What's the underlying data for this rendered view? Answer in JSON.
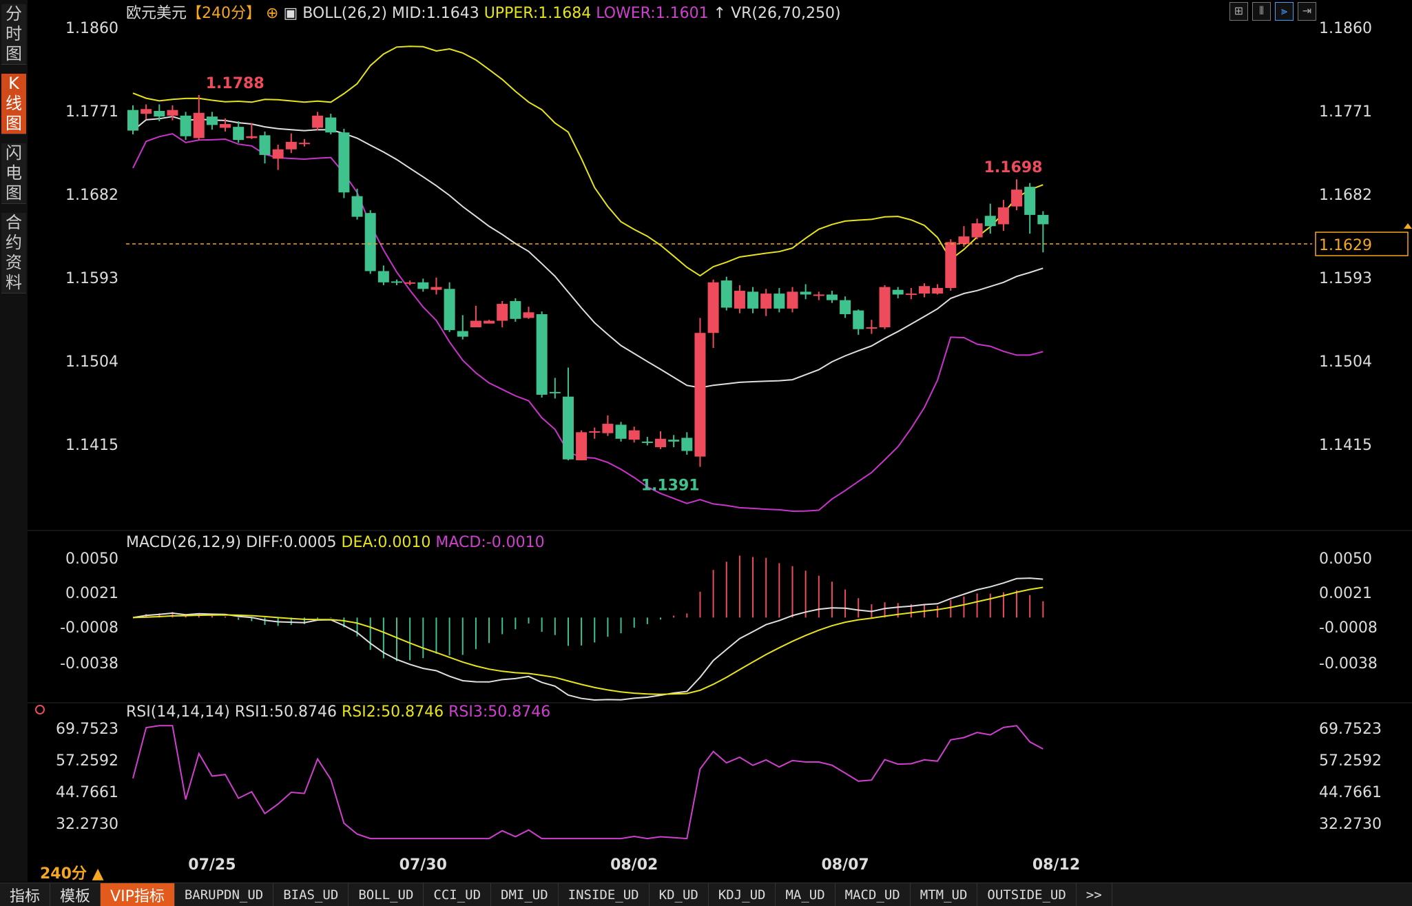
{
  "sidebar": {
    "tabs": [
      {
        "label": "分时图",
        "active": false
      },
      {
        "label": "K线图",
        "active": true
      },
      {
        "label": "闪电图",
        "active": false
      },
      {
        "label": "合约资料",
        "active": false
      }
    ]
  },
  "header": {
    "symbol": "欧元美元",
    "period": "【240分】",
    "indicator": "BOLL(26,2)",
    "mid": "MID:1.1643",
    "upper": "UPPER:1.1684",
    "lower": "LOWER:1.1601",
    "vr": "VR(26,70,250)"
  },
  "toolbar_icons": [
    "grid-icon",
    "bar-icon",
    "line-icon",
    "arrow-right-icon"
  ],
  "price_axis": {
    "ticks": [
      1.186,
      1.1771,
      1.1682,
      1.1593,
      1.1504,
      1.1415
    ],
    "tick_labels": [
      "1.1860",
      "1.1771",
      "1.1682",
      "1.1593",
      "1.1504",
      "1.1415"
    ],
    "current_price": "1.1629",
    "current_value": 1.1629
  },
  "annotations": {
    "high": {
      "label": "1.1788",
      "value": 1.1788,
      "index": 5
    },
    "low": {
      "label": "1.1391",
      "value": 1.1391,
      "index": 38
    },
    "swing": {
      "label": "1.1698",
      "value": 1.1698,
      "index": 64
    }
  },
  "macd": {
    "header": "MACD(26,12,9)",
    "diff": "DIFF:0.0005",
    "dea": "DEA:0.0010",
    "macd": "MACD:-0.0010",
    "ticks": [
      0.005,
      0.0021,
      -0.0008,
      -0.0038
    ],
    "tick_labels": [
      "0.0050",
      "0.0021",
      "-0.0008",
      "-0.0038"
    ]
  },
  "rsi": {
    "header": "RSI(14,14,14)",
    "rsi1": "RSI1:50.8746",
    "rsi2": "RSI2:50.8746",
    "rsi3": "RSI3:50.8746",
    "ticks": [
      69.7523,
      57.2592,
      44.7661,
      32.273
    ],
    "tick_labels": [
      "69.7523",
      "57.2592",
      "44.7661",
      "32.2730"
    ]
  },
  "x_axis": {
    "labels": [
      {
        "label": "07/25",
        "index": 6
      },
      {
        "label": "07/30",
        "index": 22
      },
      {
        "label": "08/02",
        "index": 38
      },
      {
        "label": "08/07",
        "index": 54
      },
      {
        "label": "08/12",
        "index": 70
      }
    ]
  },
  "period_label": "240分 ▲",
  "bottom_tabs": [
    {
      "label": "指标",
      "big": true
    },
    {
      "label": "模板",
      "big": true
    },
    {
      "label": "VIP指标",
      "big": true,
      "active": true
    },
    {
      "label": "BARUPDN_UD"
    },
    {
      "label": "BIAS_UD"
    },
    {
      "label": "BOLL_UD"
    },
    {
      "label": "CCI_UD"
    },
    {
      "label": "DMI_UD"
    },
    {
      "label": "INSIDE_UD"
    },
    {
      "label": "KD_UD"
    },
    {
      "label": "KDJ_UD"
    },
    {
      "label": "MA_UD"
    },
    {
      "label": "MACD_UD"
    },
    {
      "label": "MTM_UD"
    },
    {
      "label": "OUTSIDE_UD"
    },
    {
      "label": ">>"
    }
  ],
  "colors": {
    "up": "#ee4b5c",
    "down": "#3fc28e",
    "boll_mid": "#e0e0e0",
    "boll_upper": "#e8e41c",
    "boll_lower": "#cc33cc",
    "orange": "#f5a623"
  },
  "chart_data": {
    "type": "candlestick",
    "candles": [
      [
        1.1772,
        1.175,
        1.1777,
        1.1746
      ],
      [
        1.1768,
        1.1773,
        1.1778,
        1.1762
      ],
      [
        1.1771,
        1.1765,
        1.1778,
        1.176
      ],
      [
        1.1766,
        1.1772,
        1.1777,
        1.1761
      ],
      [
        1.1766,
        1.1744,
        1.177,
        1.174
      ],
      [
        1.1742,
        1.1769,
        1.1788,
        1.174
      ],
      [
        1.1765,
        1.1756,
        1.177,
        1.1751
      ],
      [
        1.1753,
        1.1757,
        1.1763,
        1.1749
      ],
      [
        1.1754,
        1.174,
        1.176,
        1.1737
      ],
      [
        1.1742,
        1.1744,
        1.1758,
        1.1741
      ],
      [
        1.1745,
        1.1724,
        1.1749,
        1.1715
      ],
      [
        1.172,
        1.173,
        1.1735,
        1.1708
      ],
      [
        1.173,
        1.1738,
        1.1747,
        1.1726
      ],
      [
        1.1737,
        1.1737,
        1.1741,
        1.1733
      ],
      [
        1.1753,
        1.1766,
        1.177,
        1.175
      ],
      [
        1.1764,
        1.1748,
        1.1768,
        1.1746
      ],
      [
        1.1748,
        1.1684,
        1.1752,
        1.1678
      ],
      [
        1.168,
        1.1658,
        1.1688,
        1.1655
      ],
      [
        1.1662,
        1.16,
        1.1665,
        1.1597
      ],
      [
        1.16,
        1.1588,
        1.1606,
        1.1585
      ],
      [
        1.1589,
        1.1588,
        1.1591,
        1.1585
      ],
      [
        1.1588,
        1.1588,
        1.159,
        1.1585
      ],
      [
        1.1588,
        1.1581,
        1.1592,
        1.1578
      ],
      [
        1.158,
        1.1583,
        1.1593,
        1.1575
      ],
      [
        1.1581,
        1.1537,
        1.1588,
        1.1535
      ],
      [
        1.1536,
        1.153,
        1.1553,
        1.1527
      ],
      [
        1.154,
        1.1547,
        1.1563,
        1.154
      ],
      [
        1.1544,
        1.1547,
        1.1548,
        1.1545
      ],
      [
        1.1547,
        1.1565,
        1.1568,
        1.154
      ],
      [
        1.1568,
        1.1549,
        1.1571,
        1.1546
      ],
      [
        1.155,
        1.1556,
        1.1562,
        1.1549
      ],
      [
        1.1554,
        1.1468,
        1.1557,
        1.1465
      ],
      [
        1.1471,
        1.147,
        1.1486,
        1.1464
      ],
      [
        1.1466,
        1.1399,
        1.1497,
        1.1398
      ],
      [
        1.1398,
        1.1428,
        1.143,
        1.1398
      ],
      [
        1.1428,
        1.1429,
        1.1433,
        1.1421
      ],
      [
        1.1427,
        1.1437,
        1.1446,
        1.1424
      ],
      [
        1.1436,
        1.1421,
        1.1439,
        1.1418
      ],
      [
        1.142,
        1.143,
        1.1434,
        1.1417
      ],
      [
        1.1418,
        1.1417,
        1.1423,
        1.1414
      ],
      [
        1.1412,
        1.1421,
        1.1429,
        1.141
      ],
      [
        1.142,
        1.1418,
        1.1425,
        1.1412
      ],
      [
        1.1422,
        1.1408,
        1.1428,
        1.1404
      ],
      [
        1.1402,
        1.1534,
        1.155,
        1.1391
      ],
      [
        1.1534,
        1.1588,
        1.1591,
        1.1518
      ],
      [
        1.159,
        1.1561,
        1.1594,
        1.1558
      ],
      [
        1.156,
        1.1579,
        1.1585,
        1.1555
      ],
      [
        1.1578,
        1.156,
        1.1583,
        1.1555
      ],
      [
        1.156,
        1.1576,
        1.1581,
        1.1552
      ],
      [
        1.1576,
        1.156,
        1.1582,
        1.1556
      ],
      [
        1.156,
        1.1578,
        1.1583,
        1.1556
      ],
      [
        1.1578,
        1.1575,
        1.1586,
        1.157
      ],
      [
        1.1575,
        1.1575,
        1.1578,
        1.1569
      ],
      [
        1.1575,
        1.1569,
        1.1579,
        1.1566
      ],
      [
        1.1569,
        1.1554,
        1.1573,
        1.155
      ],
      [
        1.1558,
        1.1538,
        1.1559,
        1.1532
      ],
      [
        1.154,
        1.154,
        1.1548,
        1.1533
      ],
      [
        1.154,
        1.1583,
        1.1585,
        1.1538
      ],
      [
        1.158,
        1.1575,
        1.1583,
        1.1571
      ],
      [
        1.1576,
        1.1576,
        1.1582,
        1.157
      ],
      [
        1.1576,
        1.1584,
        1.1587,
        1.1572
      ],
      [
        1.1576,
        1.1582,
        1.1586,
        1.1575
      ],
      [
        1.1582,
        1.1631,
        1.1634,
        1.1579
      ],
      [
        1.1629,
        1.1637,
        1.1648,
        1.1626
      ],
      [
        1.1636,
        1.1651,
        1.1656,
        1.1634
      ],
      [
        1.1659,
        1.1648,
        1.1672,
        1.164
      ],
      [
        1.165,
        1.1668,
        1.1676,
        1.1643
      ],
      [
        1.1669,
        1.1687,
        1.1698,
        1.1665
      ],
      [
        1.169,
        1.166,
        1.1694,
        1.164
      ],
      [
        1.166,
        1.165,
        1.1664,
        1.162
      ]
    ]
  }
}
